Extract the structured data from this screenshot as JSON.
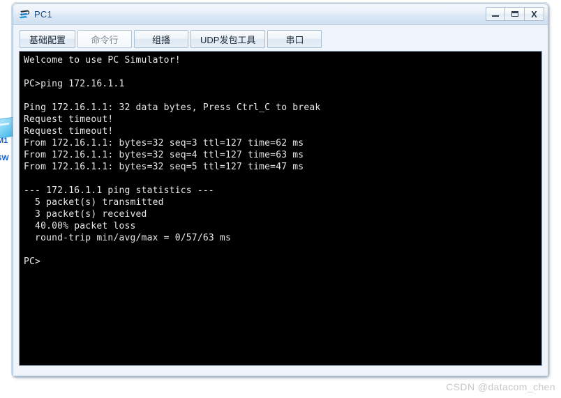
{
  "window": {
    "title": "PC1",
    "icon": "pc-simulator-icon",
    "controls": [
      {
        "name": "minimize-button",
        "label": "_",
        "glyph": "minimize-icon"
      },
      {
        "name": "maximize-button",
        "label": "□",
        "glyph": "maximize-icon"
      },
      {
        "name": "close-button",
        "label": "X",
        "glyph": "close-icon"
      }
    ]
  },
  "tabs": [
    {
      "label": "基础配置",
      "active": false
    },
    {
      "label": "命令行",
      "active": true
    },
    {
      "label": "组播",
      "active": false
    },
    {
      "label": "UDP发包工具",
      "active": false
    },
    {
      "label": "串口",
      "active": false
    }
  ],
  "terminal": {
    "prompt": "PC>",
    "target_ip": "172.16.1.1",
    "stats": {
      "transmitted": 5,
      "received": 3,
      "packet_loss": "40.00%",
      "min": 0,
      "avg": 57,
      "max": 63,
      "unit": "ms"
    },
    "replies": [
      {
        "from": "172.16.1.1",
        "bytes": 32,
        "seq": 3,
        "ttl": 127,
        "time": 62
      },
      {
        "from": "172.16.1.1",
        "bytes": 32,
        "seq": 4,
        "ttl": 127,
        "time": 63
      },
      {
        "from": "172.16.1.1",
        "bytes": 32,
        "seq": 5,
        "ttl": 127,
        "time": 47
      }
    ],
    "text": "Welcome to use PC Simulator!\n\nPC>ping 172.16.1.1\n\nPing 172.16.1.1: 32 data bytes, Press Ctrl_C to break\nRequest timeout!\nRequest timeout!\nFrom 172.16.1.1: bytes=32 seq=3 ttl=127 time=62 ms\nFrom 172.16.1.1: bytes=32 seq=4 ttl=127 time=63 ms\nFrom 172.16.1.1: bytes=32 seq=5 ttl=127 time=47 ms\n\n--- 172.16.1.1 ping statistics ---\n  5 packet(s) transmitted\n  3 packet(s) received\n  40.00% packet loss\n  round-trip min/avg/max = 0/57/63 ms\n\nPC>"
  },
  "backdrop": {
    "device_label_top": "M1",
    "device_label_bottom": "SW"
  },
  "watermark": "CSDN @datacom_chen",
  "colors": {
    "terminal_bg": "#000000",
    "terminal_fg": "#e8e8e8",
    "title_text": "#1a4e86",
    "window_chrome": "#e9f0f8"
  }
}
